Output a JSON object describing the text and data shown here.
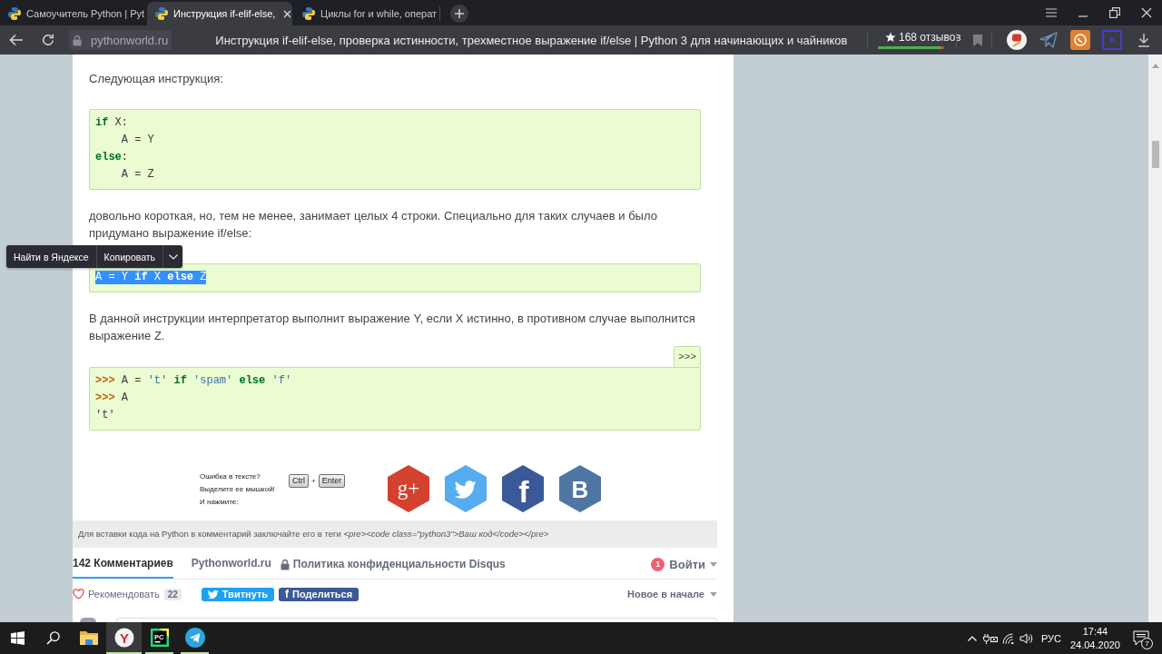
{
  "browser": {
    "tabs": [
      {
        "title": "Самоучитель Python | Pyt",
        "selected": false
      },
      {
        "title": "Инструкция if-elif-else,",
        "selected": true
      },
      {
        "title": "Циклы for и while, операт",
        "selected": false
      }
    ],
    "address_bar": {
      "domain": "pythonworld.ru",
      "page_title": "Инструкция if-elif-else, проверка истинности, трехместное выражение if/else | Python 3 для начинающих и чайников"
    },
    "reviews": {
      "label": "168 отзывов",
      "level": 0.96
    }
  },
  "article": {
    "blocks": [
      {
        "kind": "text",
        "text": "Следующая инструкция:"
      },
      {
        "kind": "code",
        "selected": false,
        "lines": [
          [
            {
              "kind": "keyword",
              "text": "if"
            },
            {
              "kind": "plain",
              "text": " X:"
            }
          ],
          [
            {
              "kind": "plain",
              "text": "    A = Y"
            }
          ],
          [
            {
              "kind": "keyword",
              "text": "else"
            },
            {
              "kind": "plain",
              "text": ":"
            }
          ],
          [
            {
              "kind": "plain",
              "text": "    A = Z"
            }
          ]
        ]
      },
      {
        "kind": "text",
        "text": "довольно короткая, но, тем не менее, занимает целых 4 строки. Специально для таких случаев и было придумано выражение if/else:"
      },
      {
        "kind": "code",
        "selected": true,
        "lines": [
          [
            {
              "kind": "plain",
              "text": "A = Y "
            },
            {
              "kind": "keyword",
              "text": "if"
            },
            {
              "kind": "plain",
              "text": " X "
            },
            {
              "kind": "keyword",
              "text": "else"
            },
            {
              "kind": "plain",
              "text": " Z"
            }
          ]
        ]
      },
      {
        "kind": "text",
        "text": "В данной инструкции интерпретатор выполнит выражение Y, если X истинно, в противном случае выполнится выражение Z."
      },
      {
        "kind": "code",
        "selected": false,
        "toggle_label": ">>>",
        "lines": [
          [
            {
              "kind": "prompt",
              "text": ">>>"
            },
            {
              "kind": "plain",
              "text": " A = "
            },
            {
              "kind": "string",
              "text": "'t'"
            },
            {
              "kind": "keyword",
              "text": " if"
            },
            {
              "kind": "string",
              "text": " 'spam'"
            },
            {
              "kind": "keyword",
              "text": " else"
            },
            {
              "kind": "string",
              "text": " 'f'"
            }
          ],
          [
            {
              "kind": "prompt",
              "text": ">>>"
            },
            {
              "kind": "plain",
              "text": " A"
            }
          ],
          [
            {
              "kind": "output",
              "text": "'t'"
            }
          ]
        ]
      }
    ]
  },
  "selection_popup": {
    "items": [
      "Найти в Яндексе",
      "Копировать"
    ]
  },
  "error_report": {
    "lines": [
      "Ошибка в тексте?",
      "Выделите ее мышкой!",
      "И нажмите:"
    ],
    "keys": [
      "Ctrl",
      "Enter"
    ],
    "separator": "+"
  },
  "share_icons": [
    {
      "kind": "googleplus",
      "glyph": "g+",
      "color": "#d4412f"
    },
    {
      "kind": "twitter",
      "color": "#55acee"
    },
    {
      "kind": "facebook",
      "glyph": "f",
      "color": "#3b5998"
    },
    {
      "kind": "vk",
      "glyph": "B",
      "color": "#4f76a3"
    }
  ],
  "code_hint": "Для вставки кода на Python в комментарий заключайте его в теги *<pre><code class=\"python3\">Ваш код</code></pre>*",
  "comments": {
    "tabs": [
      {
        "label": "142 Комментариев",
        "selected": true
      },
      {
        "label": "Pythonworld.ru",
        "selected": false
      }
    ],
    "privacy_link": "Политика конфиденциальности Disqus",
    "login": {
      "label": "Войти",
      "badge": "1"
    },
    "recommend": {
      "label": "Рекомендовать",
      "count": "22"
    },
    "share_buttons": [
      {
        "kind": "twitter",
        "label": "Твитнуть"
      },
      {
        "kind": "facebook",
        "glyph": "f",
        "label": "Поделиться"
      }
    ],
    "sort": "Новое в начале"
  },
  "taskbar": {
    "apps": [
      {
        "kind": "explorer",
        "running": false,
        "selected": false
      },
      {
        "kind": "yandex",
        "glyph": "Y",
        "running": true,
        "selected": true
      },
      {
        "kind": "pycharm",
        "glyph": "PC",
        "running": true,
        "selected": false
      },
      {
        "kind": "telegram",
        "running": true,
        "selected": false
      }
    ],
    "tray": {
      "language": "РУС",
      "time": "17:44",
      "date": "24.04.2020",
      "notification_count": "7"
    }
  }
}
